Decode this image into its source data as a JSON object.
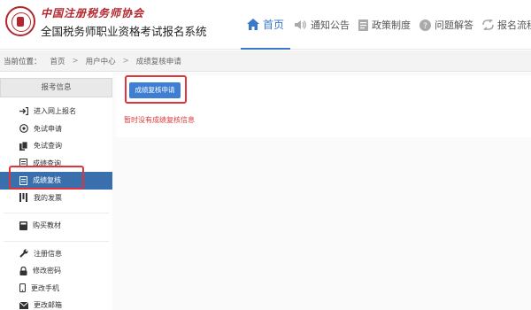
{
  "header": {
    "brand_cn": "中国注册税务师协会",
    "title": "全国税务师职业资格考试报名系统"
  },
  "nav": {
    "items": [
      {
        "label": "首页",
        "icon": "home-icon",
        "active": true
      },
      {
        "label": "通知公告",
        "icon": "speaker-icon"
      },
      {
        "label": "政策制度",
        "icon": "document-icon"
      },
      {
        "label": "问题解答",
        "icon": "question-icon"
      },
      {
        "label": "报名流程介绍",
        "icon": "flow-icon"
      }
    ]
  },
  "breadcrumb": {
    "prefix": "当前位置：",
    "items": [
      "首页",
      "用户中心",
      "成绩复核申请"
    ]
  },
  "sidebar": {
    "header": "报考信息",
    "items": [
      {
        "label": "进入网上报名",
        "icon": "enter-icon"
      },
      {
        "label": "免试申请",
        "icon": "check-circle-icon"
      },
      {
        "label": "免试查询",
        "icon": "files-icon"
      },
      {
        "label": "成绩查询",
        "icon": "doc-icon"
      },
      {
        "label": "成绩复核",
        "icon": "list-icon",
        "active": true
      },
      {
        "label": "我的发票",
        "icon": "invoice-icon"
      },
      {
        "label": "购买教材",
        "icon": "book-icon"
      },
      {
        "label": "注册信息",
        "icon": "wrench-icon"
      },
      {
        "label": "修改密码",
        "icon": "lock-icon"
      },
      {
        "label": "更改手机",
        "icon": "phone-icon"
      },
      {
        "label": "更改邮箱",
        "icon": "mail-icon"
      }
    ]
  },
  "main": {
    "apply_button": "成绩复核申请",
    "empty_message": "暂时没有成绩复核信息"
  },
  "colors": {
    "accent": "#3a78c8",
    "brand_red": "#b3262d",
    "highlight": "#e0333a",
    "active_bg": "#3a6fae"
  }
}
